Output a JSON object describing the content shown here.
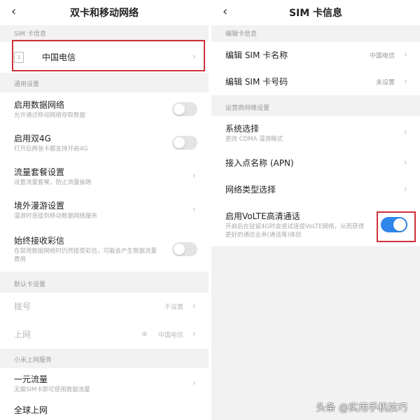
{
  "left": {
    "title": "双卡和移动网络",
    "back_icon": "‹",
    "sections": {
      "sim_info": "SIM 卡信息",
      "general": "通用设置",
      "default_card": "默认卡设置",
      "mi_net": "小米上网服务"
    },
    "sim_card": {
      "label": "中国电信",
      "slot": "1"
    },
    "general_rows": [
      {
        "label": "启用数据网络",
        "sub": "允许通过移动网络存取数据",
        "toggle": false
      },
      {
        "label": "启用双4G",
        "sub": "打开后两张卡都支持开启4G",
        "toggle": false
      },
      {
        "label": "流量套餐设置",
        "sub": "设置流量套餐，防止流量偷跑"
      },
      {
        "label": "境外漫游设置",
        "sub": "漫游时连接到移动数据网络服务"
      },
      {
        "label": "始终接收彩信",
        "sub": "在禁用数据网络时仍然接受彩信，可能会产生数据流量费用",
        "toggle": false
      }
    ],
    "default_rows": [
      {
        "label": "拨号",
        "value": "不设置"
      },
      {
        "label": "上网",
        "value": "中国电信",
        "value_icon": "⊞"
      }
    ],
    "mi_rows": [
      {
        "label": "一元流量",
        "sub": "无需SIM卡即可使用数据流量"
      },
      {
        "label": "全球上网"
      }
    ]
  },
  "right": {
    "title": "SIM 卡信息",
    "back_icon": "‹",
    "sections": {
      "edit": "编辑卡信息",
      "carrier": "运营商网络设置"
    },
    "edit_rows": [
      {
        "label": "编辑 SIM 卡名称",
        "value": "中国电信"
      },
      {
        "label": "编辑 SIM 卡号码",
        "value": "未设置"
      }
    ],
    "carrier_rows": [
      {
        "label": "系统选择",
        "sub": "更改 CDMA 漫游模式"
      },
      {
        "label": "接入点名称 (APN)"
      },
      {
        "label": "网络类型选择"
      }
    ],
    "volte": {
      "label": "启用VoLTE高清通话",
      "sub": "开启后在驻留4G时会尝试连接VoLTE网络，从而获得更好的通信业务(通话等)体验",
      "toggle": true
    }
  },
  "chevron": "›",
  "watermark": "头条 @实用手机技巧",
  "colors": {
    "accent": "#2f86ea",
    "highlight": "#d0303a"
  }
}
